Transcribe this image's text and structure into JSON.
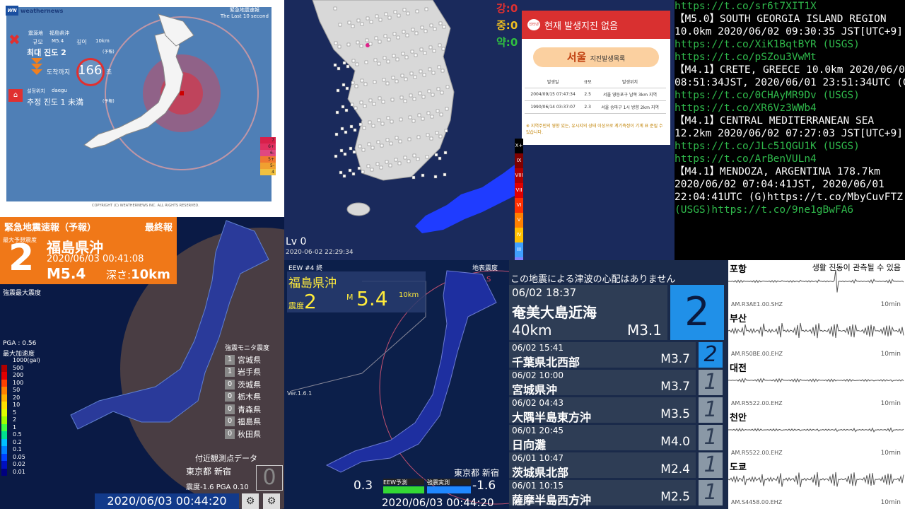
{
  "p1": {
    "brand": "weathernews",
    "brand_mark": "WN",
    "header": [
      "緊急地震速報",
      "The Last 10 second"
    ],
    "epicenter_label": "震源地",
    "epicenter": "福島県沖",
    "scale_label": "규모",
    "magnitude": "M5.4",
    "depth_label": "깊이",
    "depth": "10km",
    "max_label": "최대 진도 2",
    "forecast": "(予報)",
    "arrival_label": "도착까지",
    "countdown": "166",
    "sec": "초",
    "setloc_label": "설정위치",
    "setloc": "daegu",
    "est_label": "추정 진도 1 未満",
    "forecast2": "(予報)",
    "scale": [
      "7",
      "6+",
      "6-",
      "5+",
      "5-",
      "4"
    ],
    "copyright": "COPYRIGHT (C) WEATHERNEWS INC. ALL RIGHTS RESERVED."
  },
  "p2": {
    "levels": [
      {
        "t": "강:",
        "v": "0",
        "c": "#e03030"
      },
      {
        "t": "중:",
        "v": "0",
        "c": "#f0c020"
      },
      {
        "t": "약:",
        "v": "0",
        "c": "#30c040"
      }
    ],
    "status": "현재 발생지진 없음",
    "status_icon": "인터넷",
    "city": "서울",
    "city_sub": "지진발생목록",
    "cols": [
      "발생일",
      "규모",
      "발생위치"
    ],
    "rows": [
      [
        "2004/09/15 07:47:34",
        "2.5",
        "서울 영등포구 남쪽 3km 지역"
      ],
      [
        "1990/06/14 03:37:07",
        "2.3",
        "서울 송파구 1시 방향 2km 지역"
      ]
    ],
    "note": "※ 지역주민의 영향 있는, 유시지의 상태 이상으로 계기측정이 기계 표 준될 수 있습니다.",
    "legend": [
      "X+",
      "IX",
      "VIII",
      "VII",
      "VI",
      "V",
      "IV",
      "III",
      "II",
      "I"
    ],
    "lv": "Lv 0",
    "timestamp": "2020-06-02 22:29:34"
  },
  "p3": {
    "lines": [
      {
        "c": "g",
        "t": "https://t.co/sr6t7XIT1X"
      },
      {
        "c": "w",
        "t": ""
      },
      {
        "c": "w",
        "t": "【M5.0】SOUTH GEORGIA ISLAND REGION"
      },
      {
        "c": "w",
        "t": "10.0km 2020/06/02 09:30:35 JST[UTC+9]"
      },
      {
        "c": "g",
        "t": "https://t.co/XiK1BqtBYR (USGS)"
      },
      {
        "c": "g",
        "t": "https://t.co/pSZou3VwMt"
      },
      {
        "c": "w",
        "t": ""
      },
      {
        "c": "w",
        "t": "【M4.1】CRETE, GREECE 10.0km 2020/06/02"
      },
      {
        "c": "w",
        "t": "08:51:34JST, 2020/06/01 23:51:34UTC (G)"
      },
      {
        "c": "g",
        "t": "https://t.co/0CHAyMR9Dv (USGS)"
      },
      {
        "c": "g",
        "t": "https://t.co/XR6Vz3WWb4"
      },
      {
        "c": "w",
        "t": ""
      },
      {
        "c": "w",
        "t": "【M4.1】CENTRAL MEDITERRANEAN SEA"
      },
      {
        "c": "w",
        "t": "12.2km 2020/06/02 07:27:03 JST[UTC+9]"
      },
      {
        "c": "g",
        "t": "https://t.co/JLc51QGU1K (USGS)"
      },
      {
        "c": "g",
        "t": "https://t.co/ArBenVULn4"
      },
      {
        "c": "w",
        "t": ""
      },
      {
        "c": "w",
        "t": "【M4.1】MENDOZA, ARGENTINA 178.7km"
      },
      {
        "c": "w",
        "t": "2020/06/02 07:04:41JST, 2020/06/01"
      },
      {
        "c": "w",
        "t": "22:04:41UTC (G)https://t.co/MbyCuvFTZ"
      },
      {
        "c": "g",
        "t": "(USGS)https://t.co/9ne1gBwFA6"
      }
    ]
  },
  "p4": {
    "title": "緊急地震速報（予報）",
    "final": "最終報",
    "shindo": "2",
    "shindo_label": "最大予想震度",
    "place": "福島県沖",
    "time": "2020/06/03 00:41:08",
    "mag": "M5.4",
    "depth_label": "深さ:",
    "depth": "10km",
    "max_label": "強震最大震度",
    "pga": "PGA : 0.56",
    "acc_label": "最大加速度",
    "acc_unit": "1000(gal)",
    "scale": [
      "500",
      "200",
      "100",
      "50",
      "20",
      "10",
      "5",
      "2",
      "1",
      "0.5",
      "0.2",
      "0.1",
      "0.05",
      "0.02",
      "0.01"
    ],
    "monitor_title": "強震モニタ震度",
    "monitor": [
      [
        "1",
        "宮城県"
      ],
      [
        "1",
        "岩手県"
      ],
      [
        "0",
        "茨城県"
      ],
      [
        "0",
        "栃木県"
      ],
      [
        "0",
        "青森県"
      ],
      [
        "0",
        "福島県"
      ],
      [
        "0",
        "秋田県"
      ]
    ],
    "nearby": "付近観測点データ",
    "loc": "東京都 新宿",
    "mini": "震度-1.6  PGA 0.10",
    "zero": "0",
    "clock": "2020/06/03 00:44:20"
  },
  "p5": {
    "eew": "EEW  #4  終",
    "ground": "地表震度",
    "area": "福島県沖",
    "shindo_lbl": "震度",
    "shindo": "2",
    "mag_prefix": "M",
    "mag": "5.4",
    "depth": "10km",
    "ver": "Ver.1.6.1",
    "loc": "東京都 新宿",
    "left_val": "0.3",
    "eew_lbl": "EEW予測",
    "real_lbl": "強震実測",
    "right_val": "-1.6",
    "clock": "2020/06/03 00:44:20",
    "s": "S"
  },
  "p6": {
    "tsunami": "この地震による津波の心配はありません",
    "main": {
      "time": "06/02  18:37",
      "place": "奄美大島近海",
      "depth": "40km",
      "mag": "M3.1",
      "shindo": "2"
    },
    "rows": [
      {
        "time": "06/02  15:41",
        "place": "千葉県北西部",
        "mag": "M3.7",
        "shindo": "2",
        "hi": true
      },
      {
        "time": "06/02  10:00",
        "place": "宮城県沖",
        "mag": "M3.7",
        "shindo": "1"
      },
      {
        "time": "06/02  04:43",
        "place": "大隅半島東方沖",
        "mag": "M3.5",
        "shindo": "1"
      },
      {
        "time": "06/01  20:45",
        "place": "日向灘",
        "mag": "M4.0",
        "shindo": "1"
      },
      {
        "time": "06/01  10:47",
        "place": "茨城県北部",
        "mag": "M2.4",
        "shindo": "1"
      },
      {
        "time": "06/01  10:15",
        "place": "薩摩半島西方沖",
        "mag": "M2.5",
        "shindo": "1"
      }
    ]
  },
  "p7": {
    "caption": "생활 진동이 관측될 수 있음",
    "stations": [
      {
        "city": "포항",
        "code": "AM.R3AE1.00.SHZ",
        "win": "10min"
      },
      {
        "city": "부산",
        "code": "AM.R50BE.00.EHZ",
        "win": "10min"
      },
      {
        "city": "대전",
        "code": "AM.R5522.00.EHZ",
        "win": "10min"
      },
      {
        "city": "천안",
        "code": "AM.R5522.00.EHZ",
        "win": "10min"
      },
      {
        "city": "도쿄",
        "code": "AM.S4458.00.EHZ",
        "win": "10min"
      }
    ]
  }
}
